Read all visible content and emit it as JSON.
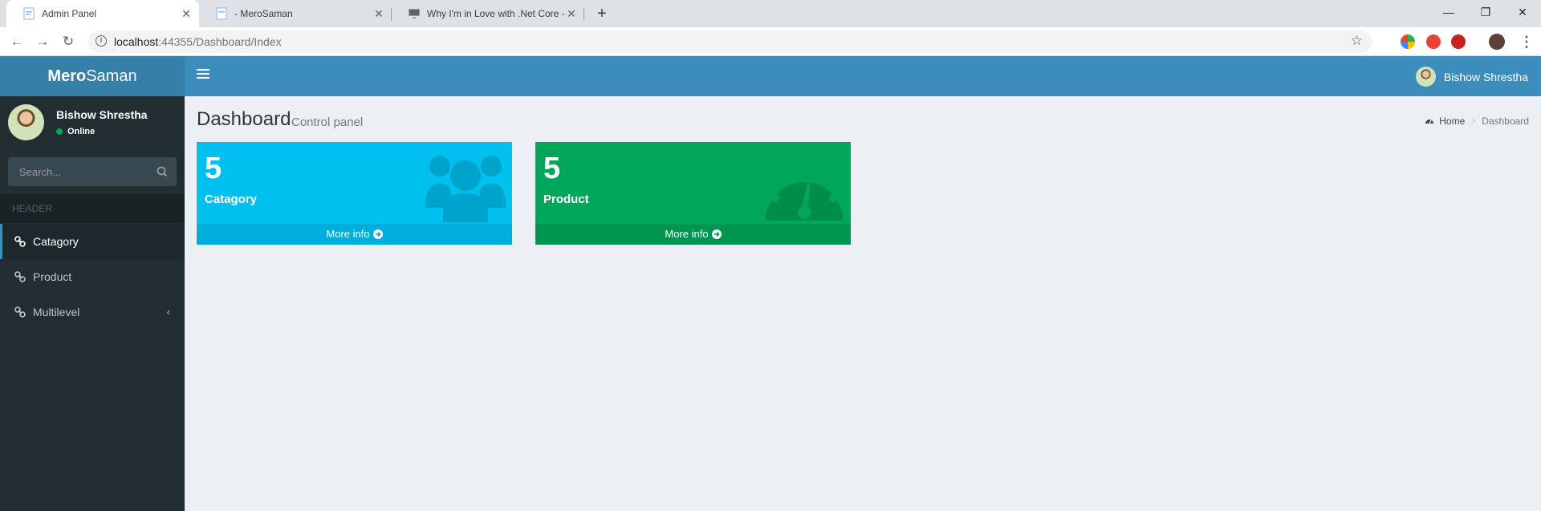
{
  "browser": {
    "tabs": [
      {
        "title": "Admin Panel",
        "active": true
      },
      {
        "title": "- MeroSaman",
        "active": false
      },
      {
        "title": "Why I'm in Love with .Net Core -",
        "active": false
      }
    ],
    "url_host": "localhost",
    "url_rest": ":44355/Dashboard/Index"
  },
  "app": {
    "logo_bold": "Mero",
    "logo_light": "Saman",
    "nav_user": "Bishow Shrestha"
  },
  "sidebar": {
    "user_name": "Bishow Shrestha",
    "status": "Online",
    "search_placeholder": "Search...",
    "header": "HEADER",
    "items": [
      {
        "label": "Catagory",
        "icon": "link-icon",
        "active": true
      },
      {
        "label": "Product",
        "icon": "link-icon",
        "active": false
      },
      {
        "label": "Multilevel",
        "icon": "link-icon",
        "active": false
      }
    ]
  },
  "content": {
    "title": "Dashboard",
    "subtitle": "Control panel",
    "breadcrumb": {
      "home": "Home",
      "current": "Dashboard"
    },
    "boxes": [
      {
        "count": "5",
        "label": "Catagory",
        "footer": "More info",
        "icon": "users-icon",
        "color": "#00c0ef"
      },
      {
        "count": "5",
        "label": "Product",
        "footer": "More info",
        "icon": "dashboard-icon",
        "color": "#00a65a"
      }
    ]
  }
}
